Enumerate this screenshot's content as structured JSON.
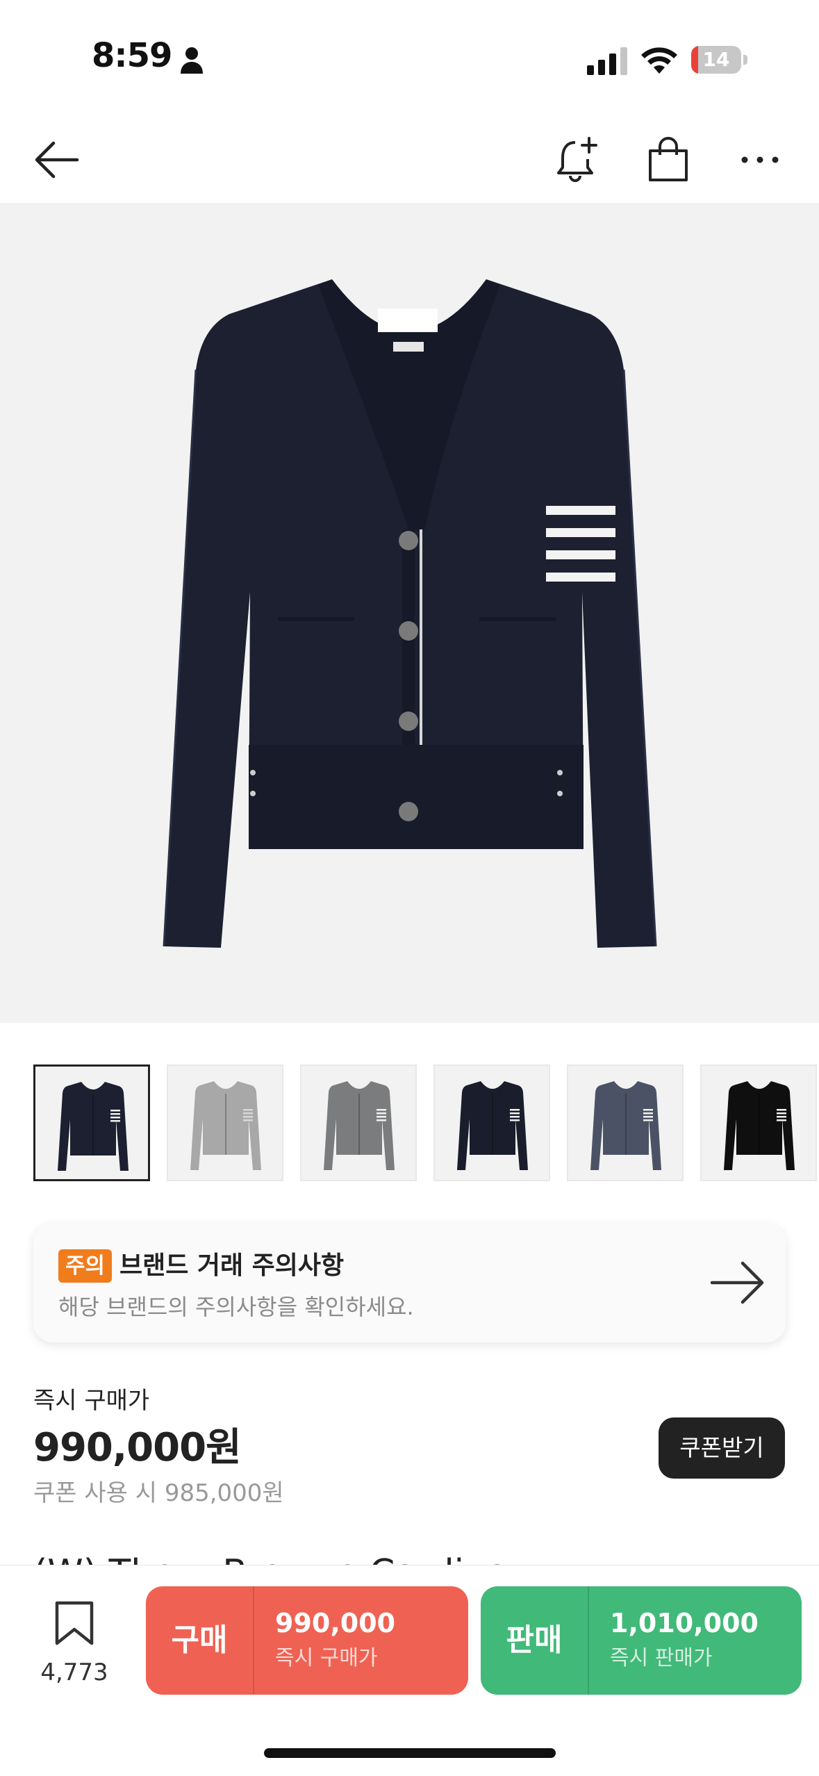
{
  "status_bar": {
    "time": "8:59",
    "battery": "14",
    "battery_level": 0.14,
    "icons": [
      "person-icon",
      "cellular-signal-icon",
      "wifi-icon",
      "battery-icon"
    ]
  },
  "nav": {
    "icons": [
      "back-arrow-icon",
      "bell-add-icon",
      "shopping-bag-icon",
      "more-icon"
    ]
  },
  "product_image": {
    "thumbnail_count": 6,
    "selected_index": 0,
    "thumbnail_colors": [
      "#1c2030",
      "#a8a8a8",
      "#7a7c7e",
      "#1a1d2b",
      "#4c5266",
      "#0f0f0f"
    ]
  },
  "notice": {
    "badge": "주의",
    "title": "브랜드 거래 주의사항",
    "subtitle": "해당 브랜드의 주의사항을 확인하세요."
  },
  "price": {
    "label": "즉시 구매가",
    "value": "990,000원",
    "coupon_price": "쿠폰 사용 시 985,000원",
    "coupon_button": "쿠폰받기"
  },
  "product_name_peek": "(W) Thom Browne Cardigan",
  "bottom_bar": {
    "wish_count": "4,773",
    "buy": {
      "label": "구매",
      "price": "990,000",
      "sub": "즉시 구매가"
    },
    "sell": {
      "label": "판매",
      "price": "1,010,000",
      "sub": "즉시 판매가"
    }
  },
  "colors": {
    "buy": "#ef6253",
    "sell": "#41b979",
    "notice_badge": "#f07c1c",
    "cardigan": "#1c2030"
  }
}
